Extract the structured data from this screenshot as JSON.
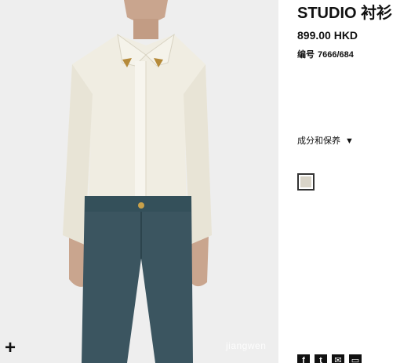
{
  "product": {
    "title": "STUDIO 衬衫",
    "price": "899.00 HKD",
    "ref_label": "编号",
    "ref_number": "7666/684"
  },
  "composition": {
    "label": "成分和保养",
    "arrow": "▼"
  },
  "colors": {
    "selected_swatch": "#d9d4c8",
    "shirt": "#f0ede2",
    "trousers": "#3b5560",
    "background": "#eeeeee"
  },
  "image": {
    "zoom_symbol": "+",
    "watermark": "jiangwen"
  },
  "share": {
    "icons": [
      "facebook-icon",
      "twitter-icon",
      "email-icon",
      "print-icon"
    ],
    "glyphs": [
      "f",
      "t",
      "✉",
      "▭"
    ]
  }
}
